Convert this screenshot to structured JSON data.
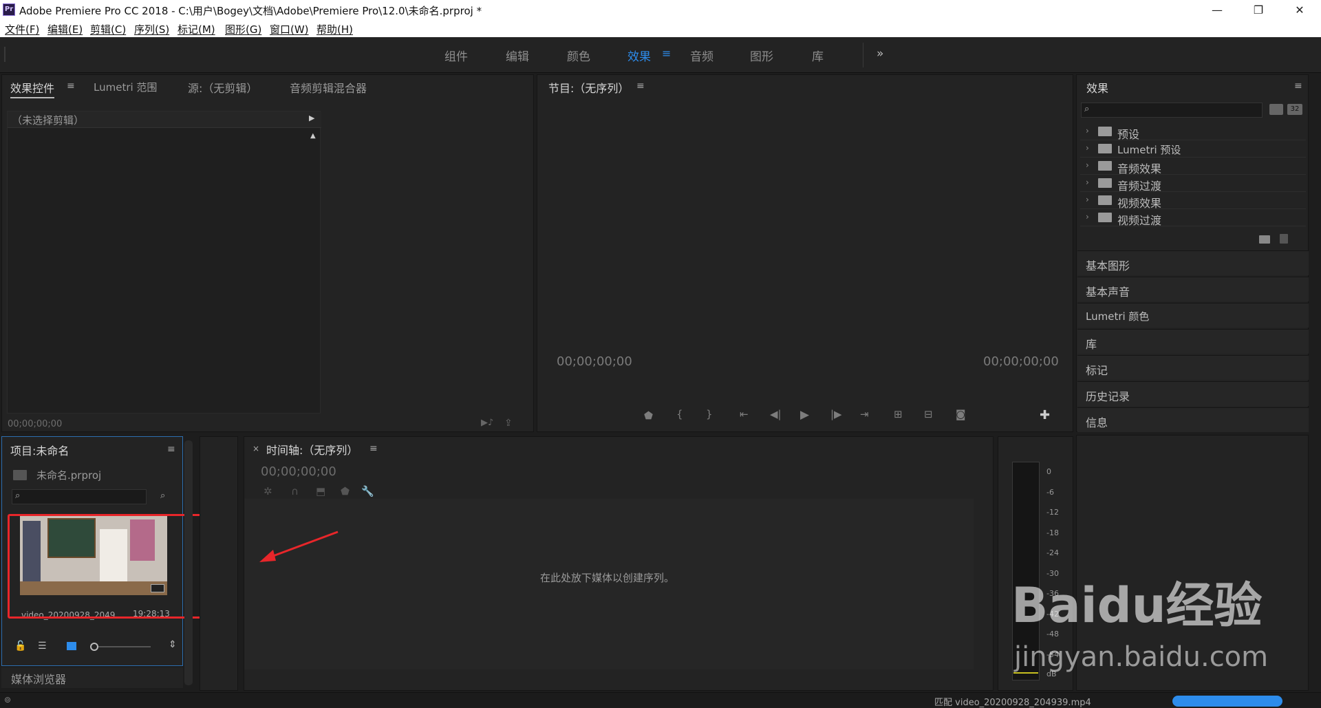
{
  "app": {
    "icon_text": "Pr",
    "title": "Adobe Premiere Pro CC 2018 - C:\\用户\\Bogey\\文档\\Adobe\\Premiere Pro\\12.0\\未命名.prproj *"
  },
  "window_controls": {
    "minimize": "—",
    "restore": "❐",
    "close": "✕"
  },
  "menu": [
    "文件(F)",
    "编辑(E)",
    "剪辑(C)",
    "序列(S)",
    "标记(M)",
    "图形(G)",
    "窗口(W)",
    "帮助(H)"
  ],
  "workspaces": [
    "组件",
    "编辑",
    "颜色",
    "效果",
    "音频",
    "图形",
    "库"
  ],
  "workspace_active": "效果",
  "workspace_more": "»",
  "source_panel": {
    "tabs": [
      "效果控件",
      "Lumetri 范围",
      "源:（无剪辑）",
      "音频剪辑混合器"
    ],
    "no_clip": "（未选择剪辑）",
    "timecode": "00;00;00;00"
  },
  "program_panel": {
    "title": "节目:（无序列）",
    "timecode_left": "00;00;00;00",
    "timecode_right": "00;00;00;00"
  },
  "effects_panel": {
    "title": "效果",
    "items": [
      "预设",
      "Lumetri 预设",
      "音频效果",
      "音频过渡",
      "视频效果",
      "视频过渡"
    ],
    "sections": [
      "基本图形",
      "基本声音",
      "Lumetri 颜色",
      "库",
      "标记",
      "历史记录",
      "信息"
    ]
  },
  "project_panel": {
    "title": "项目:未命名",
    "file": "未命名.prproj",
    "clip_name": "video_20200928_2049",
    "clip_duration": "19;28;13",
    "media_browser": "媒体浏览器"
  },
  "timeline_panel": {
    "close": "×",
    "title": "时间轴:（无序列）",
    "timecode": "00;00;00;00",
    "drop_hint": "在此处放下媒体以创建序列。"
  },
  "meter": {
    "labels": [
      "0",
      "-6",
      "-12",
      "-18",
      "-24",
      "-30",
      "-36",
      "-42",
      "-48",
      "-54",
      "dB"
    ]
  },
  "status": {
    "text": "匹配 video_20200928_204939.mp4"
  },
  "watermark": {
    "brand": "Baidu经验",
    "url": "jingyan.baidu.com"
  },
  "colors": {
    "accent": "#2d8ceb",
    "annotation": "#e8262a",
    "panel": "#232323",
    "bg": "#1d1d1d"
  }
}
